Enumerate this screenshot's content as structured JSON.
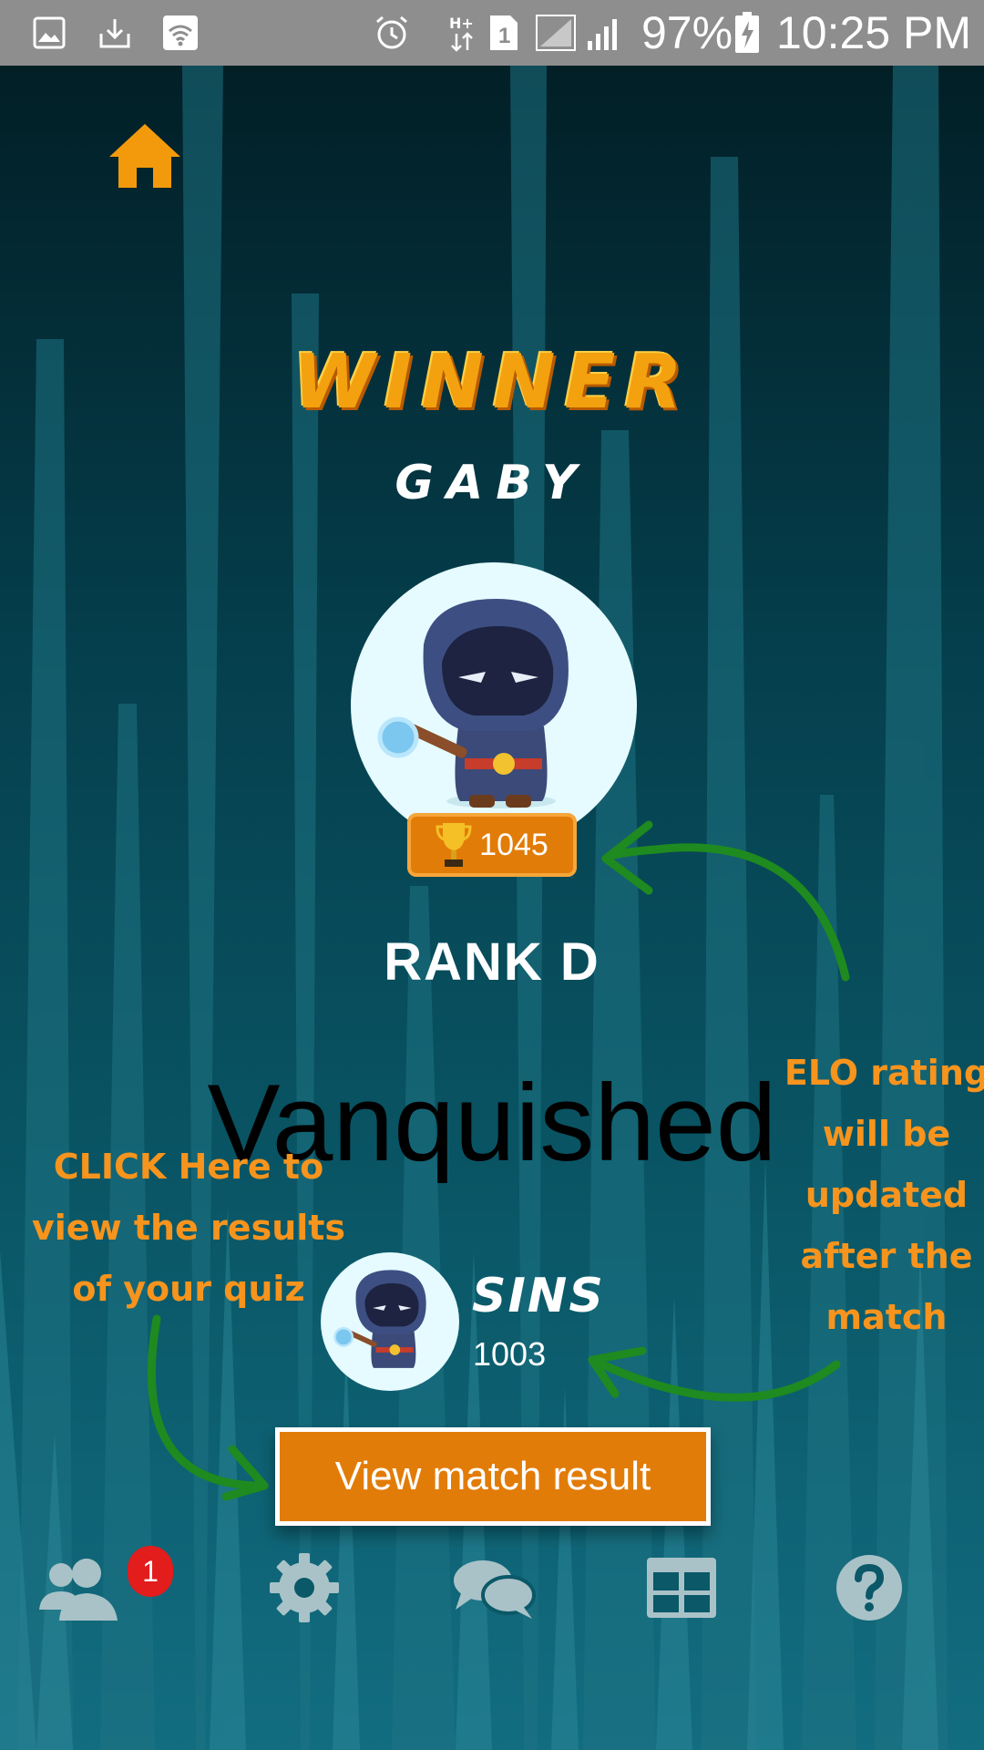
{
  "status_bar": {
    "icons": [
      "gallery-icon",
      "download-icon",
      "wifi-icon",
      "alarm-icon",
      "hplus-data-icon",
      "sim-1-icon",
      "signal-icon",
      "battery-charging-icon"
    ],
    "sim_label": "1",
    "battery": "97%",
    "time": "10:25 PM"
  },
  "header": {
    "home_icon": "home-icon"
  },
  "winner": {
    "title": "WINNER",
    "name": "GABY",
    "elo": "1045",
    "rank": "RANK D"
  },
  "vanquished_label": "Vanquished",
  "loser": {
    "name": "SINS",
    "elo": "1003"
  },
  "actions": {
    "view_result_label": "View match result"
  },
  "annotations": {
    "left": [
      "CLICK Here to",
      "view the results",
      "of your quiz"
    ],
    "right": [
      "ELO rating",
      "will be",
      "updated",
      "after the",
      "match"
    ]
  },
  "nav": {
    "items": [
      {
        "icon": "friends-icon",
        "badge": "1"
      },
      {
        "icon": "gear-icon"
      },
      {
        "icon": "chat-icon"
      },
      {
        "icon": "leaderboard-table-icon"
      },
      {
        "icon": "help-icon"
      }
    ]
  },
  "colors": {
    "accent": "#e27c08",
    "annotation": "#f7941d",
    "arrow": "#1f8a1f",
    "badge": "#e31c1c",
    "nav_icon": "#a9c2c8"
  }
}
